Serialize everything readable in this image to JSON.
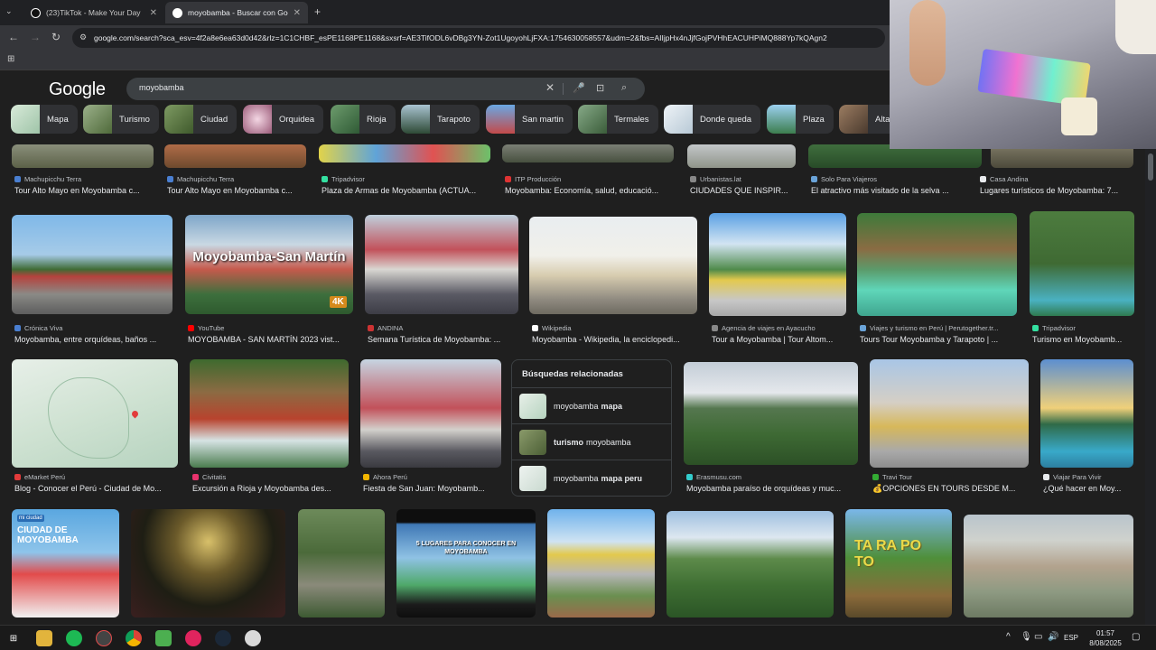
{
  "browser": {
    "tabs": [
      {
        "title": "(23)TikTok - Make Your Day",
        "active": false
      },
      {
        "title": "moyobamba - Buscar con Google",
        "active": true
      }
    ],
    "new_tab": "+",
    "url": "google.com/search?sca_esv=4f2a8e6ea63d0d42&rlz=1C1CHBF_esPE1168PE1168&sxsrf=AE3TifODL6vDBg3YN-Zot1UgoyohLjFXA:1754630058557&udm=2&fbs=AIIjpHx4nJjfGojPVHhEACUHPiMQ888Yp7kQAgn2"
  },
  "search": {
    "logo": "Google",
    "query": "moyobamba"
  },
  "chips": [
    {
      "label": "Mapa",
      "color": "#cfe3d3"
    },
    {
      "label": "Turismo",
      "color": "#6f8b54"
    },
    {
      "label": "Ciudad",
      "color": "#5d7a43"
    },
    {
      "label": "Orquidea",
      "color": "#c58aa3"
    },
    {
      "label": "Rioja",
      "color": "#4f7a4f"
    },
    {
      "label": "Tarapoto",
      "color": "#3a5b45"
    },
    {
      "label": "San martin",
      "color": "#4d7fb7"
    },
    {
      "label": "Termales",
      "color": "#5a7e59"
    },
    {
      "label": "Donde queda",
      "color": "#dbe6ee"
    },
    {
      "label": "Plaza",
      "color": "#4d8a63"
    },
    {
      "label": "Alta",
      "color": "#6a5241"
    }
  ],
  "row0": [
    {
      "source": "Machupicchu Terra",
      "title": "Tour Alto Mayo en Moyobamba c..."
    },
    {
      "source": "Machupicchu Terra",
      "title": "Tour Alto Mayo en Moyobamba c..."
    },
    {
      "source": "Tripadvisor",
      "title": "Plaza de Armas de Moyobamba (ACTUA..."
    },
    {
      "source": "ITP Producción",
      "title": "Moyobamba: Economía, salud, educació..."
    },
    {
      "source": "Urbanistas.lat",
      "title": "CIUDADES QUE INSPIR..."
    },
    {
      "source": "Solo Para Viajeros",
      "title": "El atractivo más visitado de la selva ..."
    },
    {
      "source": "Casa Andina",
      "title": "Lugares turísticos de Moyobamba: 7..."
    }
  ],
  "row1": [
    {
      "source": "Crónica Viva",
      "title": "Moyobamba, entre orquídeas, baños ..."
    },
    {
      "source": "YouTube",
      "title": "MOYOBAMBA - SAN MARTÍN 2023 vist...",
      "overlay": "Moyobamba-San Martín",
      "badge": "4K"
    },
    {
      "source": "ANDINA",
      "title": "Semana Turística de Moyobamba: ..."
    },
    {
      "source": "Wikipedia",
      "title": "Moyobamba - Wikipedia, la enciclopedi..."
    },
    {
      "source": "Agencia de viajes en Ayacucho",
      "title": "Tour a Moyobamba | Tour Altom..."
    },
    {
      "source": "Viajes y turismo en Perú | Perutogether.tr...",
      "title": "Tours Tour Moyobamba y Tarapoto | ..."
    },
    {
      "source": "Tripadvisor",
      "title": "Turismo en Moyobamb..."
    }
  ],
  "row2": [
    {
      "source": "eMarket Perú",
      "title": "Blog - Conocer el Perú - Ciudad de Mo..."
    },
    {
      "source": "Civitatis",
      "title": "Excursión a Rioja y Moyobamba des..."
    },
    {
      "source": "Ahora Perú",
      "title": "Fiesta de San Juan: Moyobamb..."
    },
    {
      "source": "Erasmusu.com",
      "title": "Moyobamba paraíso de orquídeas y muc..."
    },
    {
      "source": "Travi Tour",
      "title": "💰OPCIONES EN TOURS DESDE M..."
    },
    {
      "source": "Viajar Para Vivir",
      "title": "¿Qué hacer en Moy..."
    }
  ],
  "row3_texts": {
    "ciudad_title": "CIUDAD DE MOYOBAMBA",
    "ciudad_brand": "mi ciudad",
    "lugares": "5 LUGARES PARA CONOCER EN MOYOBAMBA",
    "tarapoto": "TA RA PO TO"
  },
  "related": {
    "title": "Búsquedas relacionadas",
    "items": [
      {
        "prefix": "moyobamba ",
        "bold": "mapa",
        "suffix": ""
      },
      {
        "prefix": "",
        "bold": "turismo",
        "suffix": " moyobamba"
      },
      {
        "prefix": "moyobamba ",
        "bold": "mapa peru",
        "suffix": ""
      }
    ]
  },
  "taskbar": {
    "lang": "ESP",
    "time": "01:57",
    "date": "8/08/2025"
  }
}
